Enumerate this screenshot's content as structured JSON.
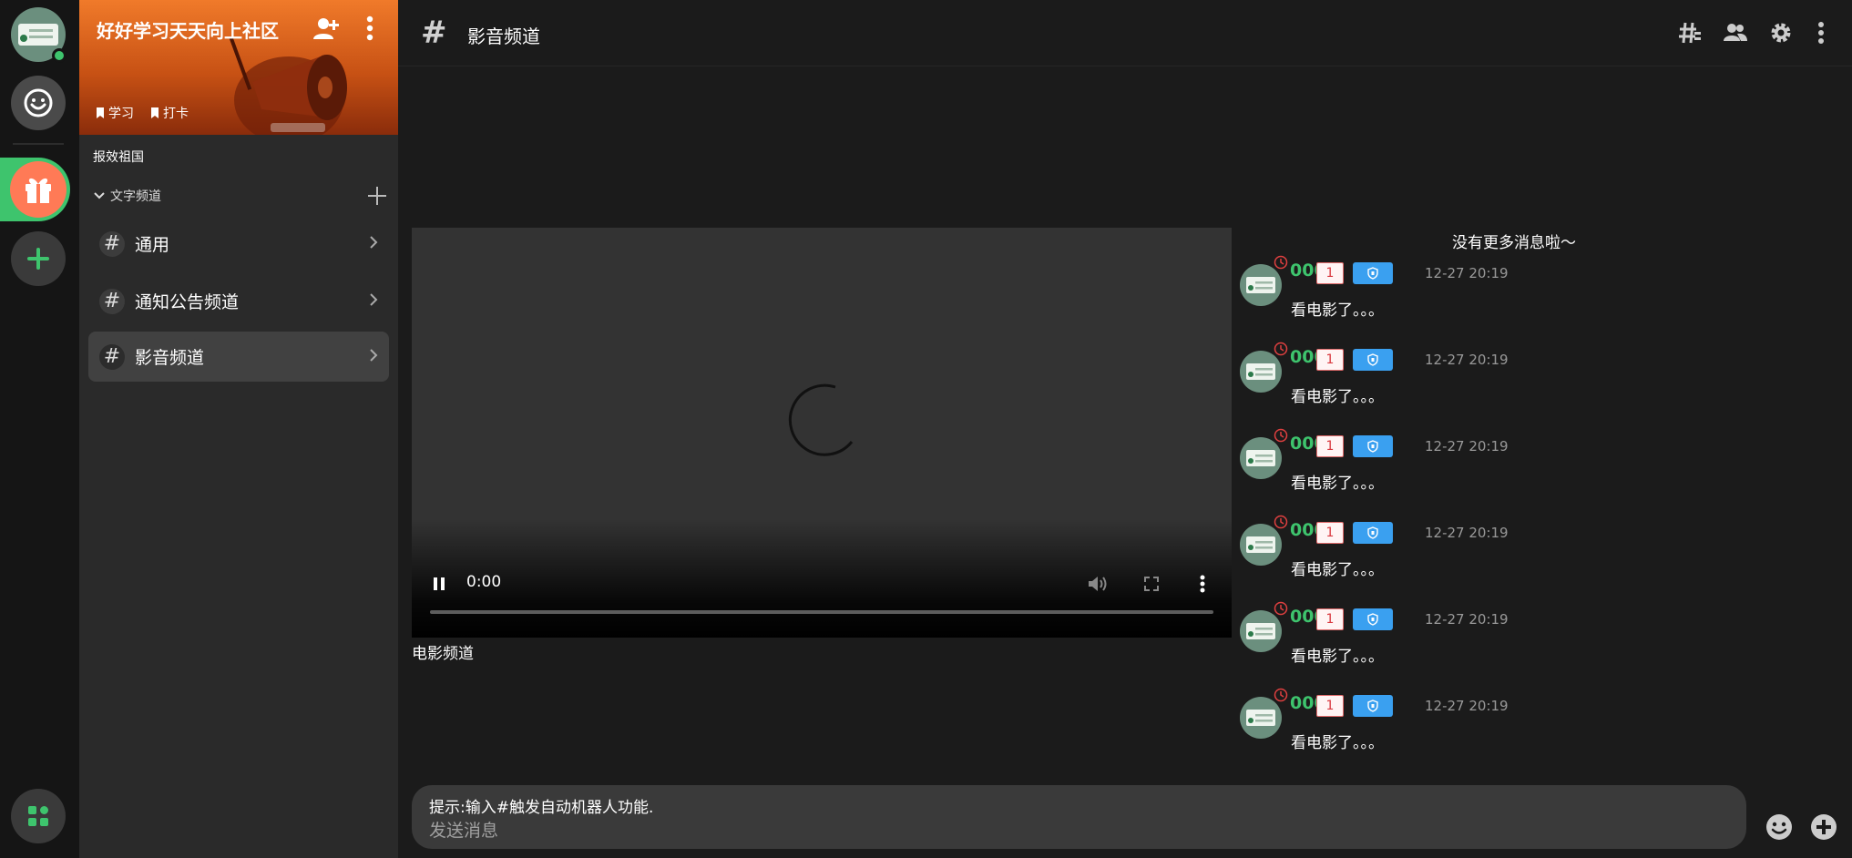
{
  "server": {
    "name": "好好学习天天向上社区",
    "tags": [
      "学习",
      "打卡"
    ],
    "description": "报效祖国"
  },
  "sidebar": {
    "category": "文字频道",
    "channels": [
      {
        "label": "通用",
        "active": false
      },
      {
        "label": "通知公告频道",
        "active": false
      },
      {
        "label": "影音频道",
        "active": true
      }
    ]
  },
  "header": {
    "title": "影音频道"
  },
  "video": {
    "current_time": "0:00",
    "caption": "电影频道"
  },
  "messages": {
    "no_more": "没有更多消息啦～",
    "items": [
      {
        "name": "0001",
        "badge": "1",
        "time": "12-27 20:19",
        "text": "看电影了。。。"
      },
      {
        "name": "0001",
        "badge": "1",
        "time": "12-27 20:19",
        "text": "看电影了。。。"
      },
      {
        "name": "0001",
        "badge": "1",
        "time": "12-27 20:19",
        "text": "看电影了。。。"
      },
      {
        "name": "0001",
        "badge": "1",
        "time": "12-27 20:19",
        "text": "看电影了。。。"
      },
      {
        "name": "0001",
        "badge": "1",
        "time": "12-27 20:19",
        "text": "看电影了。。。"
      },
      {
        "name": "0001",
        "badge": "1",
        "time": "12-27 20:19",
        "text": "看电影了。。。"
      }
    ]
  },
  "composer": {
    "hint": "提示:输入#触发自动机器人功能.",
    "placeholder": "发送消息"
  },
  "colors": {
    "accent_green": "#3ec46d",
    "banner_orange": "#f07a2a",
    "role_blue": "#3aa0f0",
    "badge_red": "#d8373d"
  }
}
